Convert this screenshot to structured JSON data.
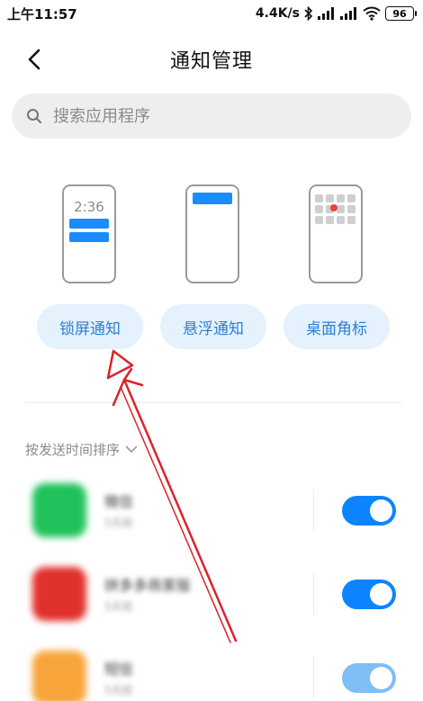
{
  "status_bar": {
    "time": "上午11:57",
    "net_speed": "4.4K/s",
    "battery": "96"
  },
  "header": {
    "title": "通知管理"
  },
  "search": {
    "placeholder": "搜索应用程序"
  },
  "illustrations": {
    "lock_screen_clock": "2:36"
  },
  "modes": [
    {
      "label": "锁屏通知"
    },
    {
      "label": "悬浮通知"
    },
    {
      "label": "桌面角标"
    }
  ],
  "sort": {
    "label": "按发送时间排序"
  },
  "apps": [
    {
      "name": "微信",
      "subtitle": "5天前",
      "enabled": true
    },
    {
      "name": "拼多多商家版",
      "subtitle": "5天前",
      "enabled": true
    },
    {
      "name": "短信",
      "subtitle": "5天前",
      "enabled": true
    }
  ],
  "colors": {
    "accent": "#0d84ff",
    "pill_background": "#e5f1fd",
    "pill_text": "#2a7fd4",
    "annotation_arrow": "#d9232a",
    "wechat_green": "#1fc25a",
    "pdd_red": "#e0312c",
    "sms_orange": "#f7a53a"
  }
}
